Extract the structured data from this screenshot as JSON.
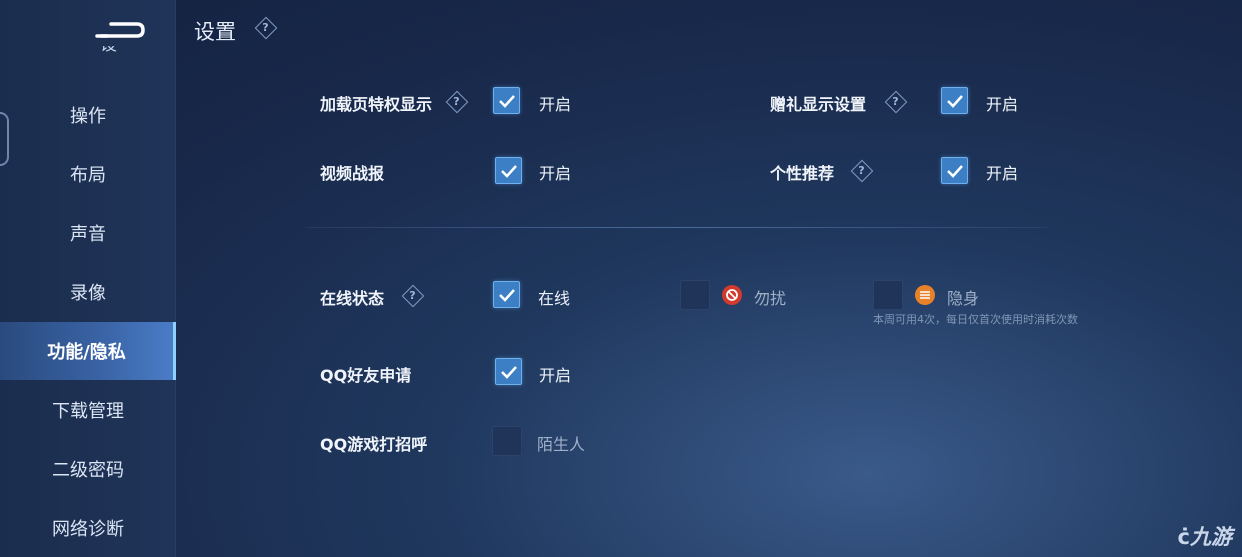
{
  "header": {
    "title": "设置"
  },
  "sidebar": {
    "partial_item": "设",
    "items": [
      {
        "label": "操作"
      },
      {
        "label": "布局"
      },
      {
        "label": "声音"
      },
      {
        "label": "录像"
      },
      {
        "label": "功能/隐私",
        "active": true
      },
      {
        "label": "下载管理"
      },
      {
        "label": "二级密码"
      },
      {
        "label": "网络诊断"
      }
    ]
  },
  "settings": {
    "loading_privilege": {
      "label": "加载页特权显示",
      "checked": true,
      "option": "开启"
    },
    "gift_display": {
      "label": "赠礼显示设置",
      "checked": true,
      "option": "开启"
    },
    "video_report": {
      "label": "视频战报",
      "checked": true,
      "option": "开启"
    },
    "personal_recommend": {
      "label": "个性推荐",
      "checked": true,
      "option": "开启"
    },
    "online_status": {
      "label": "在线状态",
      "online": {
        "text": "在线",
        "checked": true
      },
      "dnd": {
        "text": "勿扰",
        "checked": false
      },
      "invisible": {
        "text": "隐身",
        "checked": false
      },
      "note": "本周可用4次，每日仅首次使用时消耗次数"
    },
    "qq_friend_request": {
      "label": "QQ好友申请",
      "checked": true,
      "option": "开启"
    },
    "qq_game_greeting": {
      "label": "QQ游戏打招呼",
      "checked": false,
      "option": "陌生人"
    }
  },
  "watermark": "九游",
  "colors": {
    "accent": "#3d7fc4",
    "dnd": "#d23a2e",
    "invisible": "#e8822a"
  },
  "icons": {
    "help": "?"
  }
}
